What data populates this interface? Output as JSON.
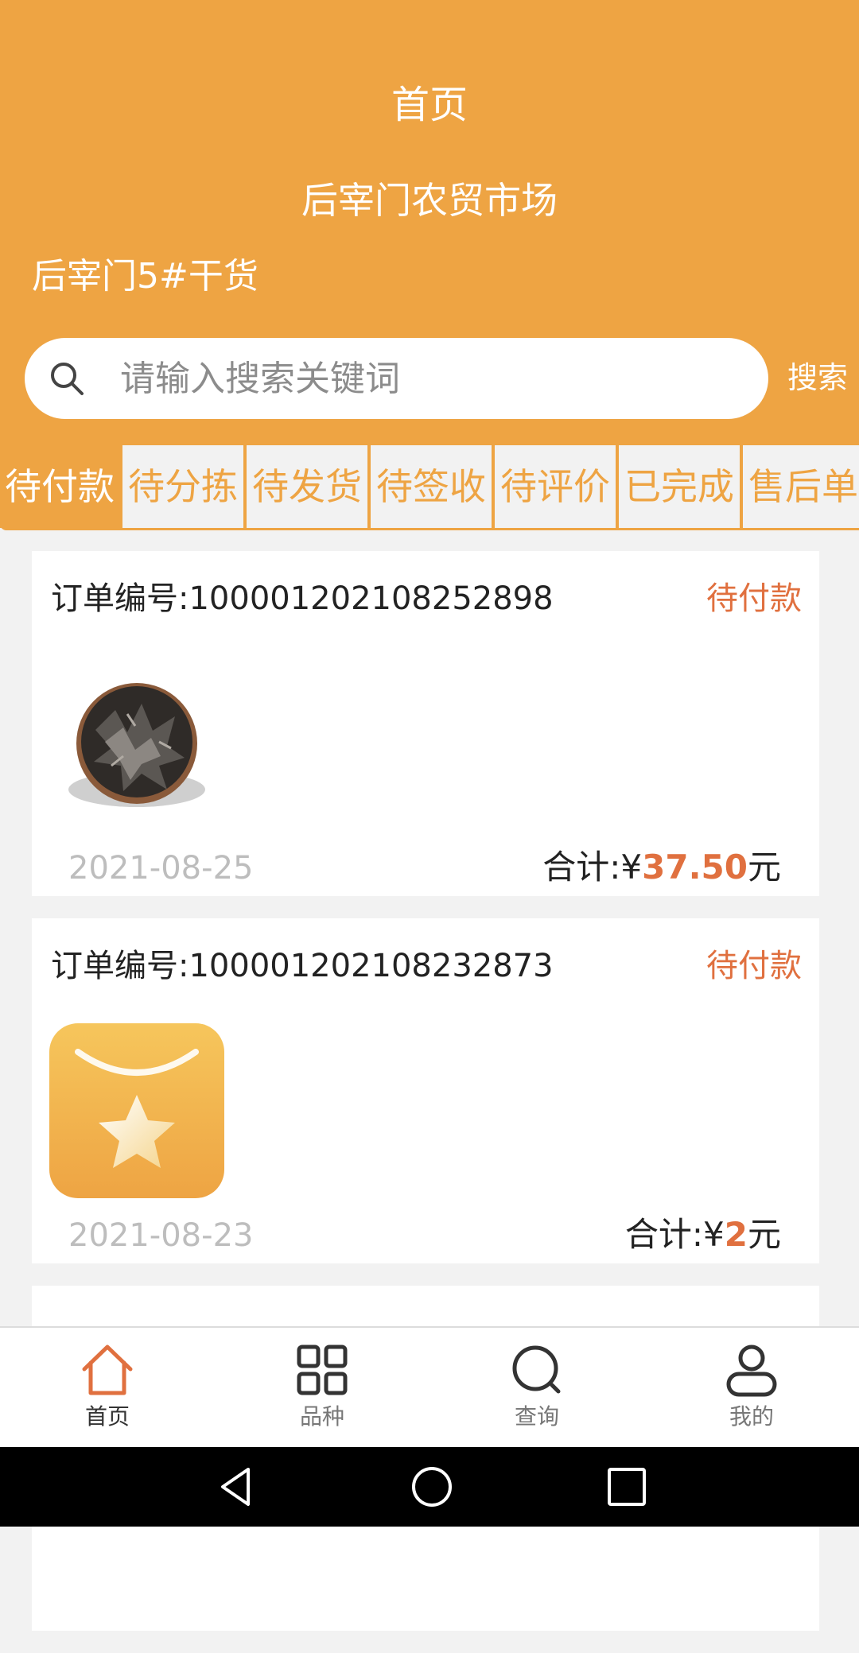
{
  "header": {
    "title": "首页",
    "market": "后宰门农贸市场",
    "shop": "后宰门5#干货"
  },
  "search": {
    "placeholder": "请输入搜索关键词",
    "button": "搜索",
    "icon": "search-icon"
  },
  "tabs": [
    {
      "label": "待付款",
      "active": true
    },
    {
      "label": "待分拣"
    },
    {
      "label": "待发货"
    },
    {
      "label": "待签收"
    },
    {
      "label": "待评价"
    },
    {
      "label": "已完成"
    },
    {
      "label": "售后单"
    }
  ],
  "orders": [
    {
      "number_label": "订单编号:",
      "number": "100001202108252898",
      "status": "待付款",
      "date": "2021-08-25",
      "total_label": "合计:",
      "currency": "¥",
      "amount": "37.50",
      "unit": "元",
      "image": "dried-black-fungus-image"
    },
    {
      "number_label": "订单编号:",
      "number": "100001202108232873",
      "status": "待付款",
      "date": "2021-08-23",
      "total_label": "合计:",
      "currency": "¥",
      "amount": "2",
      "unit": "元",
      "image": "placeholder-star-app-icon"
    }
  ],
  "nav": [
    {
      "label": "首页",
      "icon": "home-icon",
      "active": true
    },
    {
      "label": "品种",
      "icon": "grid-icon"
    },
    {
      "label": "查询",
      "icon": "search-icon"
    },
    {
      "label": "我的",
      "icon": "user-icon"
    }
  ],
  "colors": {
    "primary": "#eea443",
    "accent": "#e0703f",
    "background": "#f2f2f2"
  }
}
